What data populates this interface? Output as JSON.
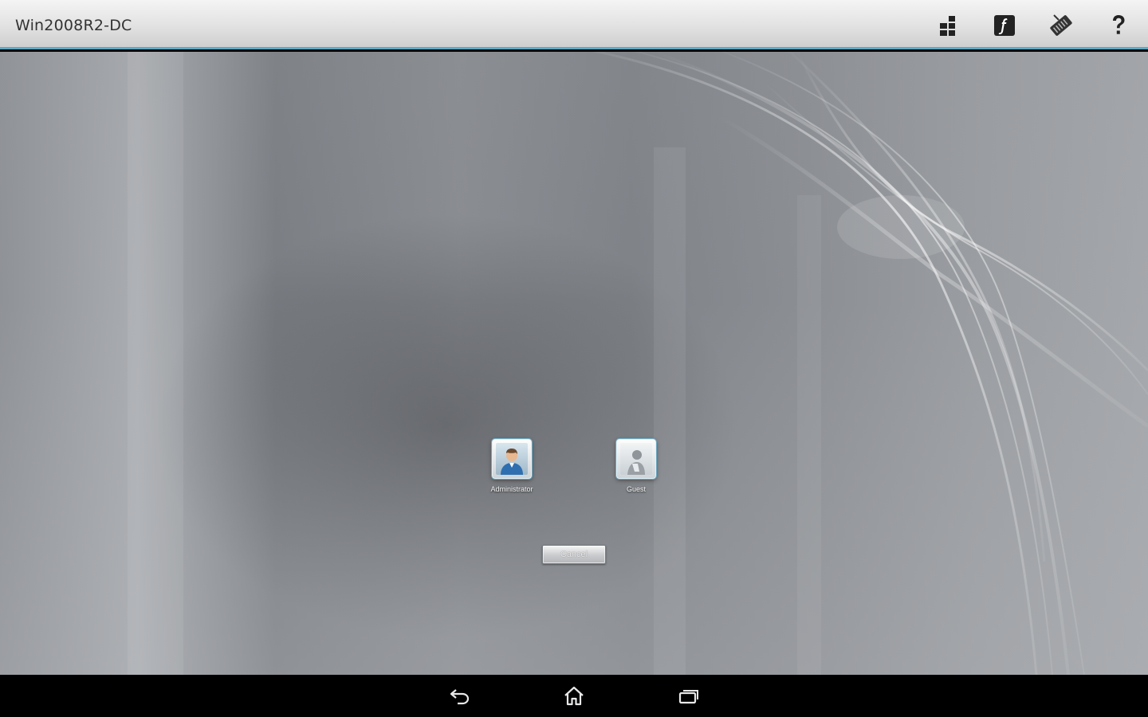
{
  "app": {
    "title": "Win2008R2-DC"
  },
  "toolbar": {
    "buttons": [
      {
        "icon": "keyboard-grid-icon"
      },
      {
        "icon": "function-keys-icon"
      },
      {
        "icon": "extra-keys-icon"
      },
      {
        "icon": "help-icon"
      }
    ]
  },
  "login": {
    "users": [
      {
        "name": "Administrator"
      },
      {
        "name": "Guest"
      }
    ],
    "cancel_label": "Cancel"
  },
  "navbar": {
    "buttons": [
      {
        "icon": "back-icon"
      },
      {
        "icon": "home-icon"
      },
      {
        "icon": "recent-apps-icon"
      }
    ]
  },
  "colors": {
    "accent": "#5fa7c4",
    "navbar": "#000000",
    "topbar": "#e2e2e2"
  }
}
